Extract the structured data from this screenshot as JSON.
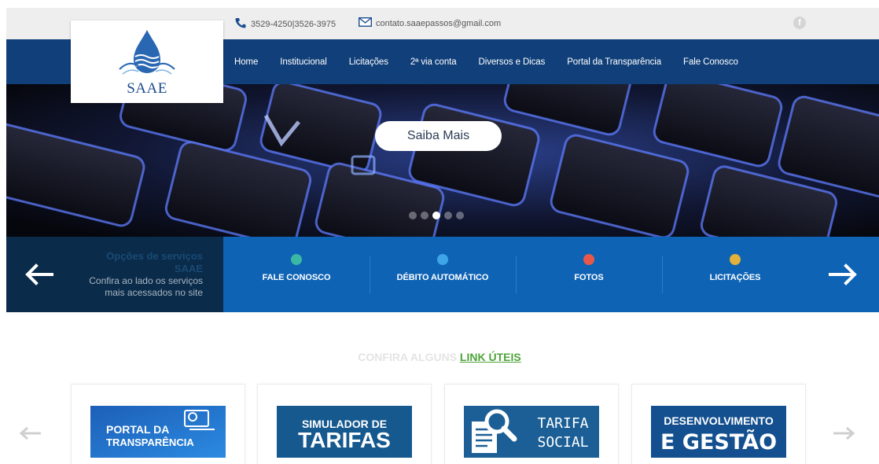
{
  "topbar": {
    "phone": "3529-4250|3526-3975",
    "email": "contato.saaepassos@gmail.com",
    "facebook_glyph": "f"
  },
  "logo": {
    "text": "SAAE"
  },
  "nav": {
    "items": [
      "Home",
      "Institucional",
      "Licitações",
      "2ª via conta",
      "Diversos e Dicas",
      "Portal da Transparência",
      "Fale Conosco"
    ]
  },
  "hero": {
    "button": "Saiba Mais",
    "slide_count": 5,
    "active_slide": 3
  },
  "services": {
    "title_line1": "Opções de serviços",
    "title_line2": "SAAE",
    "subtitle_line1": "Confira ao lado os serviços",
    "subtitle_line2": "mais acessados no site",
    "items": [
      {
        "label": "FALE CONOSCO",
        "icon": "support-agent-icon",
        "color": "#3bb7a3"
      },
      {
        "label": "DÉBITO AUTOMÁTICO",
        "icon": "coin-icon",
        "color": "#3ea6e8"
      },
      {
        "label": "FOTOS",
        "icon": "camera-icon",
        "color": "#e8584a"
      },
      {
        "label": "LICITAÇÕES",
        "icon": "money-bag-icon",
        "color": "#e2b13c"
      }
    ]
  },
  "links": {
    "title_muted": "CONFIRA ALGUNS",
    "title_link": "LINK ÚTEIS",
    "cards": [
      {
        "line1": "PORTAL DA",
        "line2": "TRANSPARÊNCIA"
      },
      {
        "line1": "SIMULADOR DE",
        "line2": "TARIFAS"
      },
      {
        "line1": "TARIFA",
        "line2": "SOCIAL"
      },
      {
        "line1": "DESENVOLVIMENTO",
        "line2": "E GESTÃO"
      }
    ]
  },
  "colors": {
    "nav": "#103f79",
    "services_dark": "#0a2b4a",
    "services_blue": "#0e63b5",
    "accent_green": "#4ea33a"
  }
}
